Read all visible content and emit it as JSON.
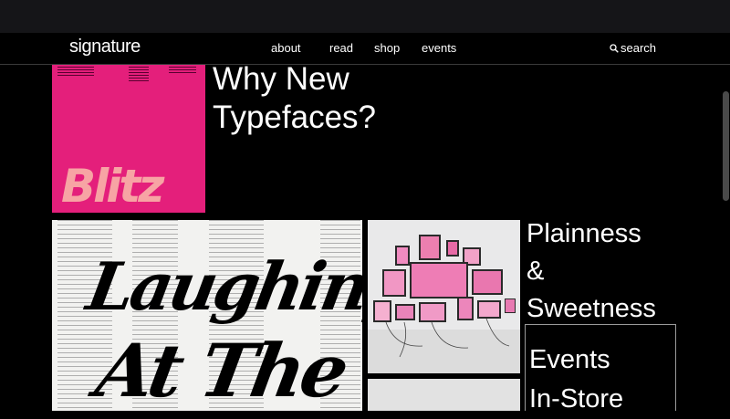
{
  "nav": {
    "logo": "signature",
    "links": [
      "about",
      "read",
      "shop",
      "events"
    ],
    "search_label": "search"
  },
  "cards": {
    "blitz": {
      "cover_word": "Blitz",
      "headline_line1": "Why New",
      "headline_line2": "Typefaces?"
    },
    "laughing": {
      "cover_line1": "Laughing",
      "cover_line2": "At The"
    },
    "plainness": {
      "title_line1": "Plainness",
      "title_line2": "&",
      "title_line3": "Sweetness"
    },
    "events": {
      "title_line1": "Events",
      "title_line2": "In-Store"
    }
  },
  "colors": {
    "blitz_pink": "#e41f7b",
    "blitz_text": "#f7a4a4",
    "background": "#000000"
  }
}
